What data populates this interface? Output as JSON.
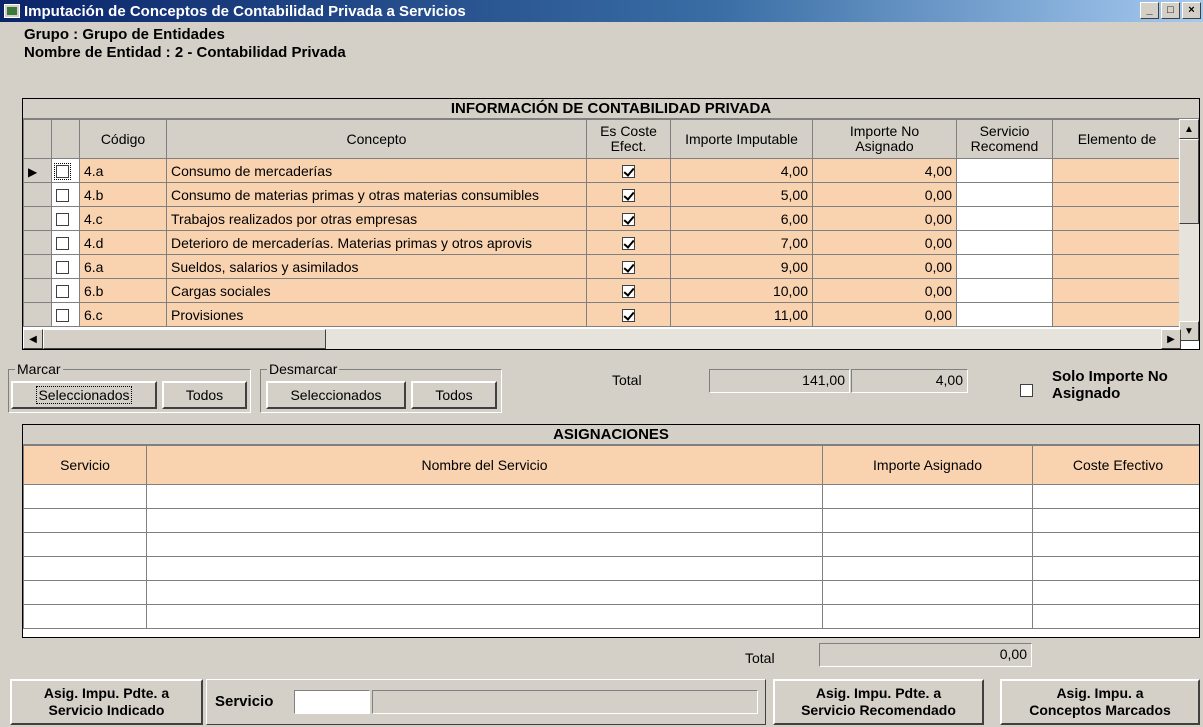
{
  "window": {
    "title": "Imputación de Conceptos de Contabilidad Privada a Servicios",
    "minimize": "_",
    "maximize": "□",
    "close": "×"
  },
  "header": {
    "grupo": "Grupo : Grupo de Entidades",
    "entidad": "Nombre de Entidad : 2 - Contabilidad Privada"
  },
  "info_grid": {
    "title": "INFORMACIÓN DE CONTABILIDAD PRIVADA",
    "columns": {
      "codigo": "Código",
      "concepto": "Concepto",
      "es_coste_1": "Es Coste",
      "es_coste_2": "Efect.",
      "importe_imputable": "Importe Imputable",
      "importe_no_1": "Importe No",
      "importe_no_2": "Asignado",
      "servicio_1": "Servicio",
      "servicio_2": "Recomend",
      "elemento": "Elemento de"
    },
    "rows": [
      {
        "codigo": "4.a",
        "concepto": "Consumo de mercaderías",
        "imputable": "4,00",
        "no_asignado": "4,00"
      },
      {
        "codigo": "4.b",
        "concepto": "Consumo de materias primas y otras materias consumibles",
        "imputable": "5,00",
        "no_asignado": "0,00"
      },
      {
        "codigo": "4.c",
        "concepto": "Trabajos realizados por otras empresas",
        "imputable": "6,00",
        "no_asignado": "0,00"
      },
      {
        "codigo": "4.d",
        "concepto": "Deterioro de mercaderías. Materias primas y otros aprovis",
        "imputable": "7,00",
        "no_asignado": "0,00"
      },
      {
        "codigo": "6.a",
        "concepto": "Sueldos, salarios y asimilados",
        "imputable": "9,00",
        "no_asignado": "0,00"
      },
      {
        "codigo": "6.b",
        "concepto": "Cargas sociales",
        "imputable": "10,00",
        "no_asignado": "0,00"
      },
      {
        "codigo": "6.c",
        "concepto": "Provisiones",
        "imputable": "11,00",
        "no_asignado": "0,00"
      }
    ]
  },
  "marcar": {
    "legend": "Marcar",
    "seleccionados": "Seleccionados",
    "todos": "Todos"
  },
  "desmarcar": {
    "legend": "Desmarcar",
    "seleccionados": "Seleccionados",
    "todos": "Todos"
  },
  "totals": {
    "label": "Total",
    "imputable": "141,00",
    "no_asignado": "4,00",
    "solo_importe_1": "Solo Importe No",
    "solo_importe_2": "Asignado"
  },
  "asignaciones": {
    "title": "ASIGNACIONES",
    "columns": {
      "servicio": "Servicio",
      "nombre": "Nombre del Servicio",
      "importe": "Importe Asignado",
      "coste": "Coste Efectivo"
    },
    "total_label": "Total",
    "total_value": "0,00"
  },
  "bottom": {
    "btn_indicado_1": "Asig. Impu. Pdte. a",
    "btn_indicado_2": "Servicio Indicado",
    "servicio_label": "Servicio",
    "btn_recomendado_1": "Asig. Impu. Pdte. a",
    "btn_recomendado_2": "Servicio Recomendado",
    "btn_marcados_1": "Asig. Impu. a",
    "btn_marcados_2": "Conceptos Marcados"
  }
}
